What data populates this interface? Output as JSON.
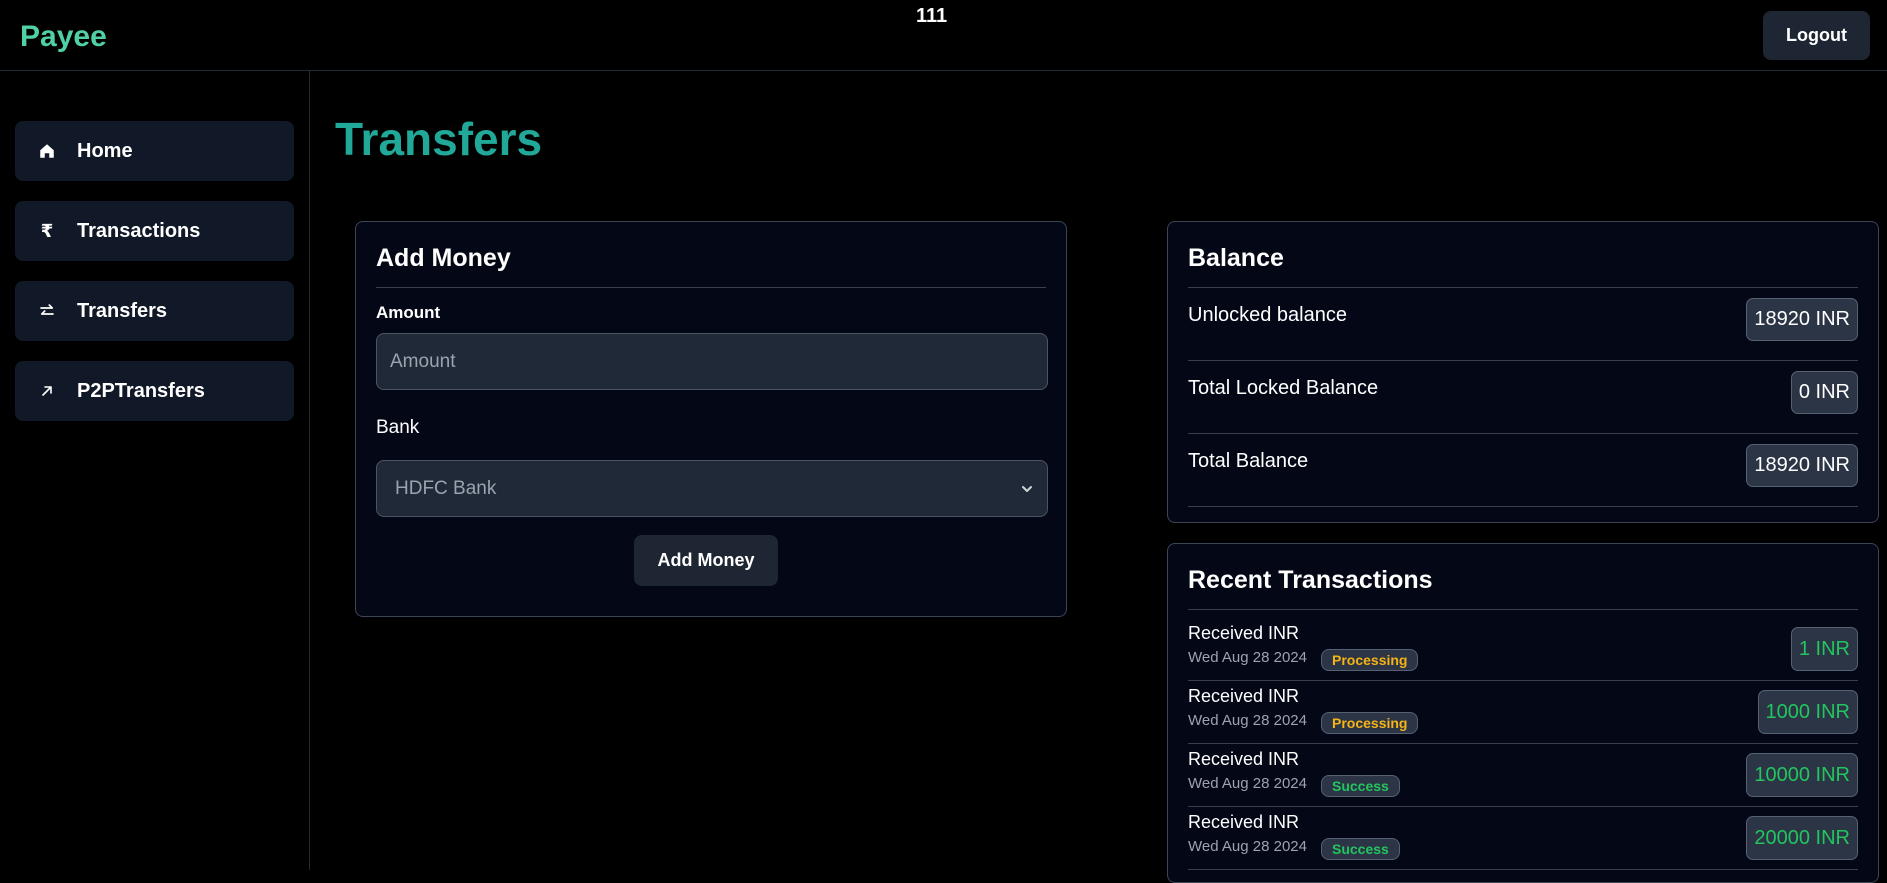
{
  "header": {
    "brand": "Payee",
    "center_text": "111",
    "logout_label": "Logout"
  },
  "sidebar": {
    "items": [
      {
        "label": "Home",
        "icon": "home-icon"
      },
      {
        "label": "Transactions",
        "icon": "rupee-icon"
      },
      {
        "label": "Transfers",
        "icon": "arrows-swap-icon"
      },
      {
        "label": "P2PTransfers",
        "icon": "arrow-up-right-icon"
      }
    ]
  },
  "main": {
    "title": "Transfers"
  },
  "add_money": {
    "title": "Add Money",
    "amount_label": "Amount",
    "amount_placeholder": "Amount",
    "bank_label": "Bank",
    "bank_selected": "HDFC Bank",
    "button_label": "Add Money"
  },
  "balance": {
    "title": "Balance",
    "rows": [
      {
        "label": "Unlocked balance",
        "value": "18920 INR"
      },
      {
        "label": "Total Locked Balance",
        "value": "0 INR"
      },
      {
        "label": "Total Balance",
        "value": "18920 INR"
      }
    ]
  },
  "recent": {
    "title": "Recent Transactions",
    "items": [
      {
        "title": "Received INR",
        "date": "Wed Aug 28 2024",
        "status": "Processing",
        "amount": "1 INR"
      },
      {
        "title": "Received INR",
        "date": "Wed Aug 28 2024",
        "status": "Processing",
        "amount": "1000 INR"
      },
      {
        "title": "Received INR",
        "date": "Wed Aug 28 2024",
        "status": "Success",
        "amount": "10000 INR"
      },
      {
        "title": "Received INR",
        "date": "Wed Aug 28 2024",
        "status": "Success",
        "amount": "20000 INR"
      }
    ]
  },
  "colors": {
    "brand": "#4fd1a5",
    "title": "#21a898",
    "processing": "#f5b316",
    "success": "#22c55e"
  }
}
